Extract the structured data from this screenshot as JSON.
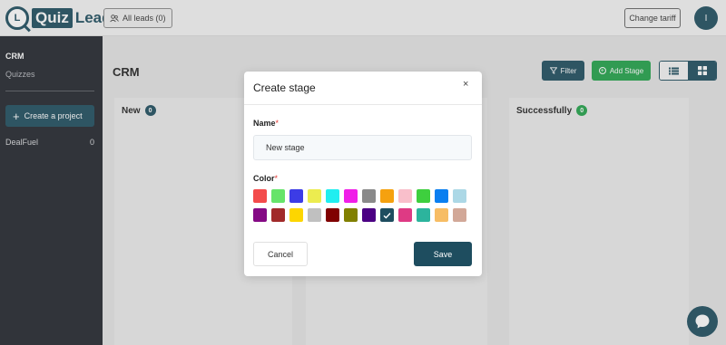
{
  "header": {
    "logo_letter": "L",
    "logo_quiz": "Quiz",
    "logo_lead": "Lead",
    "all_leads_label": "All leads (0)",
    "change_tariff_label": "Change tariff",
    "avatar_initial": "I"
  },
  "sidebar": {
    "crm_label": "CRM",
    "quizzes_label": "Quizzes",
    "create_project_label": "Create a project",
    "projects": [
      {
        "name": "DealFuel",
        "count": "0"
      }
    ]
  },
  "main": {
    "page_title": "CRM",
    "filter_label": "Filter",
    "add_stage_label": "Add Stage",
    "columns": [
      {
        "title": "New",
        "count": "0",
        "badge_color": "#1e4d5f"
      },
      {
        "title": "Successfully",
        "count": "0",
        "badge_color": "#22a34a"
      }
    ]
  },
  "modal": {
    "title": "Create stage",
    "close_glyph": "×",
    "name_label": "Name",
    "required_mark": "*",
    "name_value": "New stage",
    "color_label": "Color",
    "colors": [
      "#f34b4b",
      "#66e46a",
      "#3c3ce6",
      "#ecec4f",
      "#20eef0",
      "#f01ee8",
      "#8a8a8a",
      "#f5a10f",
      "#f9bfcb",
      "#3ecf3e",
      "#0a7ff0",
      "#acd8e6",
      "#850a85",
      "#a12a2a",
      "#fdd600",
      "#c0c0c0",
      "#800000",
      "#818000",
      "#4b0083",
      "#1e4d5f",
      "#de3a84",
      "#2cb49d",
      "#f7bd64",
      "#d2a898"
    ],
    "selected_color_index": 19,
    "cancel_label": "Cancel",
    "save_label": "Save"
  }
}
